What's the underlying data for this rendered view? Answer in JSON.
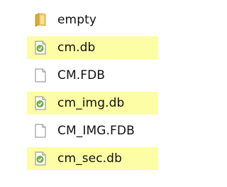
{
  "files": [
    {
      "name": "empty",
      "icon": "folder-icon",
      "highlighted": false
    },
    {
      "name": "cm.db",
      "icon": "db-file-icon",
      "highlighted": true
    },
    {
      "name": "CM.FDB",
      "icon": "blank-file-icon",
      "highlighted": false
    },
    {
      "name": "cm_img.db",
      "icon": "db-file-icon",
      "highlighted": true
    },
    {
      "name": "CM_IMG.FDB",
      "icon": "blank-file-icon",
      "highlighted": false
    },
    {
      "name": "cm_sec.db",
      "icon": "db-file-icon",
      "highlighted": true
    }
  ],
  "colors": {
    "highlight": "#fdfda6",
    "folder": "#e8c15a",
    "db_icon": "#6fa93b"
  }
}
